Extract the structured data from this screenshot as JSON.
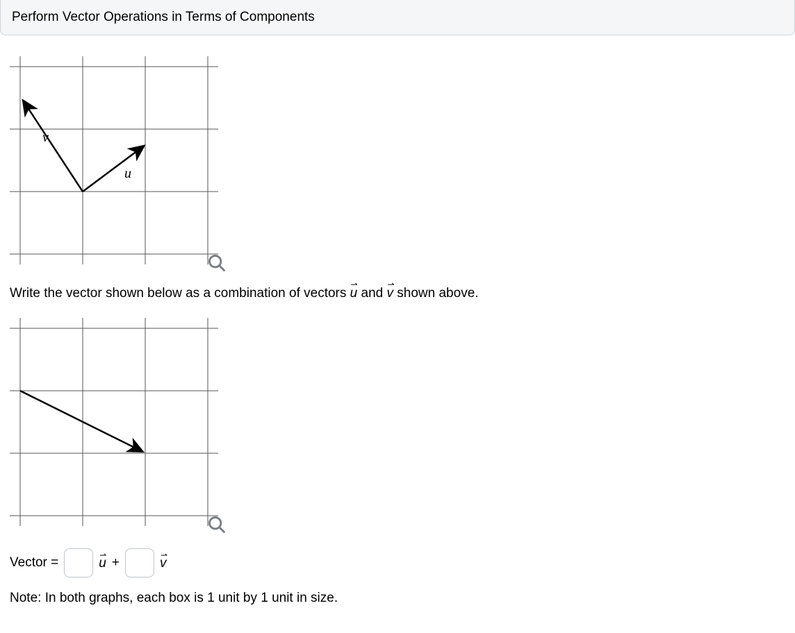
{
  "header": {
    "title": "Perform Vector Operations in Terms of Components"
  },
  "instruction": {
    "pre": "Write the vector shown below as a combination of vectors ",
    "mid": " and ",
    "post": " shown above."
  },
  "chart_data": [
    {
      "type": "vector-grid",
      "grid": {
        "cols": 3,
        "rows": 3,
        "unit": 1
      },
      "vectors": [
        {
          "name": "v",
          "from": [
            1,
            1
          ],
          "to": [
            0,
            2.5
          ],
          "label_pos": [
            0.35,
            1.85
          ]
        },
        {
          "name": "u",
          "from": [
            1,
            1
          ],
          "to": [
            2,
            1.75
          ],
          "label_pos": [
            1.65,
            1.25
          ]
        }
      ]
    },
    {
      "type": "vector-grid",
      "grid": {
        "cols": 3,
        "rows": 3,
        "unit": 1
      },
      "vectors": [
        {
          "name": "",
          "from": [
            0,
            2
          ],
          "to": [
            2,
            1
          ],
          "label_pos": null
        }
      ]
    }
  ],
  "labels": {
    "v": "v",
    "u": "u"
  },
  "answer": {
    "lhs": "Vector =",
    "u_coef": "",
    "plus": "+",
    "v_coef": "",
    "u_sym": "u",
    "v_sym": "v",
    "arrow": "⇀"
  },
  "note": "Note: In both graphs, each box is 1 unit by 1 unit in size."
}
